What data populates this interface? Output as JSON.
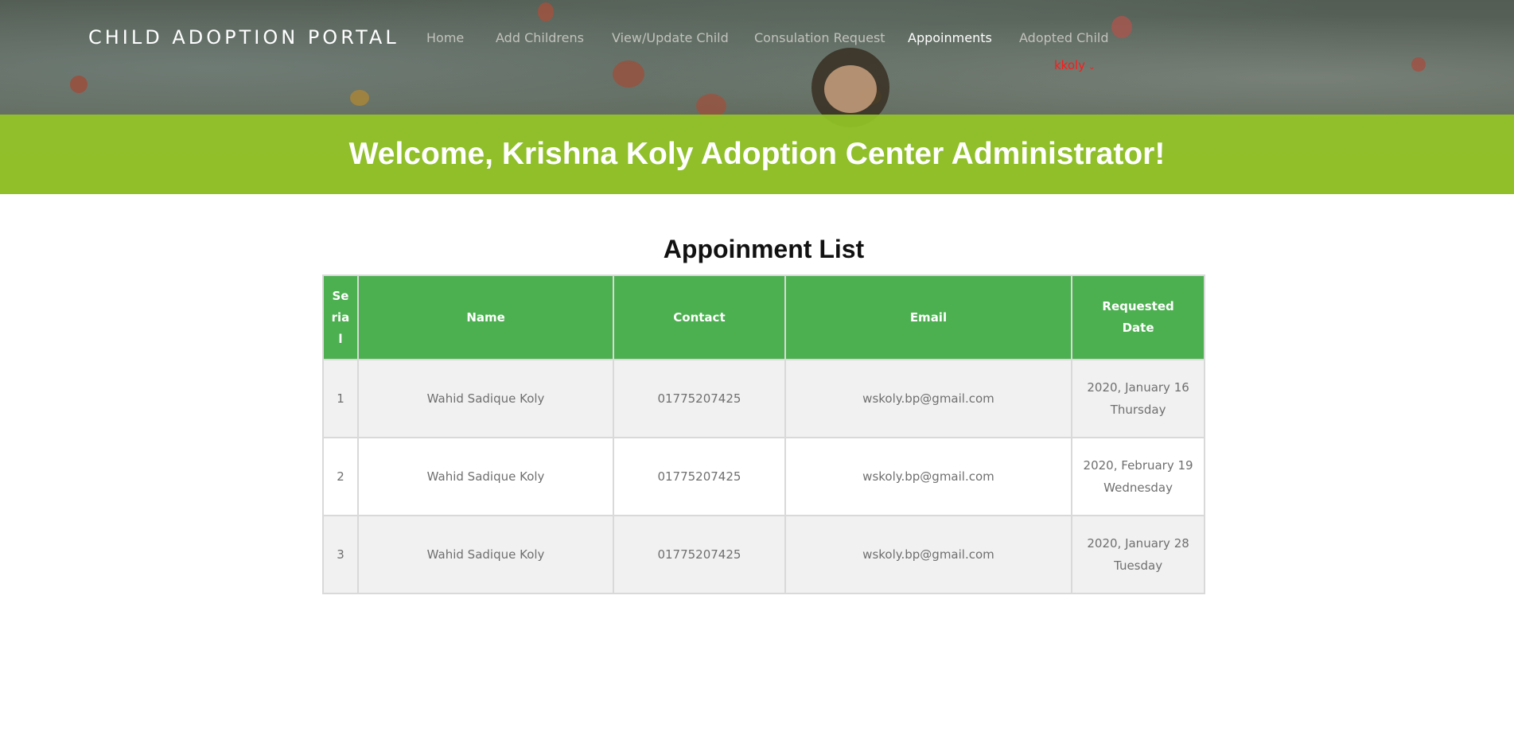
{
  "header": {
    "brand": "CHILD ADOPTION PORTAL",
    "nav": [
      {
        "label": "Home",
        "active": false
      },
      {
        "label": "Add Childrens",
        "active": false
      },
      {
        "label": "View/Update Child",
        "active": false
      },
      {
        "label": "Consulation Request",
        "active": false
      },
      {
        "label": "Appoinments",
        "active": true
      },
      {
        "label": "Adopted Child",
        "active": false
      }
    ],
    "user_menu": {
      "label": "kkoly",
      "icon": "chevron-down-icon",
      "color": "#ff1a1a"
    }
  },
  "welcome": {
    "text": "Welcome, Krishna Koly Adoption Center Administrator!",
    "band_color": "#92c426"
  },
  "main": {
    "title": "Appoinment List",
    "table": {
      "header_color": "#4caf50",
      "columns": [
        "Serial",
        "Name",
        "Contact",
        "Email",
        "Requested Date"
      ],
      "rows": [
        {
          "serial": "1",
          "name": "Wahid Sadique Koly",
          "contact": "01775207425",
          "email": "wskoly.bp@gmail.com",
          "date": "2020, January 16",
          "weekday": "Thursday"
        },
        {
          "serial": "2",
          "name": "Wahid Sadique Koly",
          "contact": "01775207425",
          "email": "wskoly.bp@gmail.com",
          "date": "2020, February 19",
          "weekday": "Wednesday"
        },
        {
          "serial": "3",
          "name": "Wahid Sadique Koly",
          "contact": "01775207425",
          "email": "wskoly.bp@gmail.com",
          "date": "2020, January 28",
          "weekday": "Tuesday"
        }
      ]
    }
  }
}
